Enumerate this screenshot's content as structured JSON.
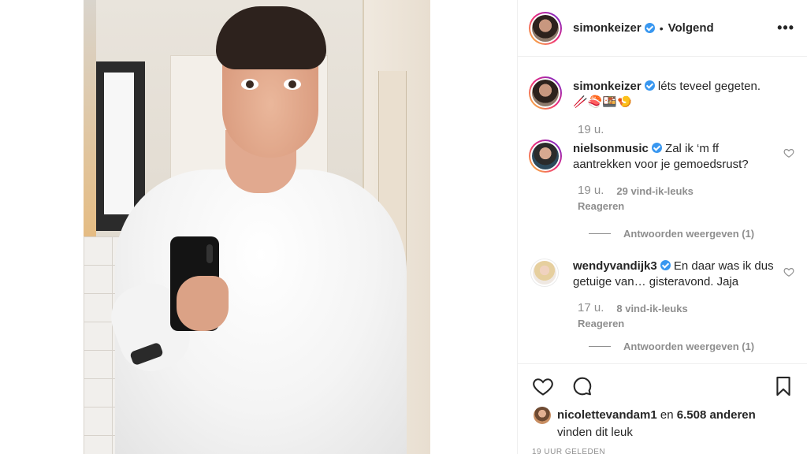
{
  "post": {
    "author": "simonkeizer",
    "separator": "•",
    "follow_label": "Volgend",
    "more_label": "•••",
    "caption": "léts teveel gegeten. 🥢🍣🍱🍤",
    "caption_time": "19 u."
  },
  "comments": [
    {
      "user": "nielsonmusic",
      "text": "Zal ik ‘m ff aantrekken voor je gemoedsrust?",
      "time": "19 u.",
      "likes": "29 vind-ik-leuks",
      "reply_label": "Reageren",
      "view_replies": "Antwoorden weergeven (1)"
    },
    {
      "user": "wendyvandijk3",
      "text": "En daar was ik dus getuige van… gisteravond. Jaja",
      "time": "17 u.",
      "likes": "8 vind-ik-leuks",
      "reply_label": "Reageren",
      "view_replies": "Antwoorden weergeven (1)"
    }
  ],
  "likes_summary": {
    "user": "nicolettevandam1",
    "and": "en",
    "count": "6.508 anderen",
    "suffix": "vinden dit leuk"
  },
  "timestamp": "19 UUR GELEDEN",
  "icons": {
    "like": "heart-icon",
    "comment": "comment-icon",
    "save": "bookmark-icon",
    "more": "more-options-icon"
  },
  "colors": {
    "verified": "#3897f0",
    "text": "#262626",
    "muted": "#8e8e8e"
  }
}
